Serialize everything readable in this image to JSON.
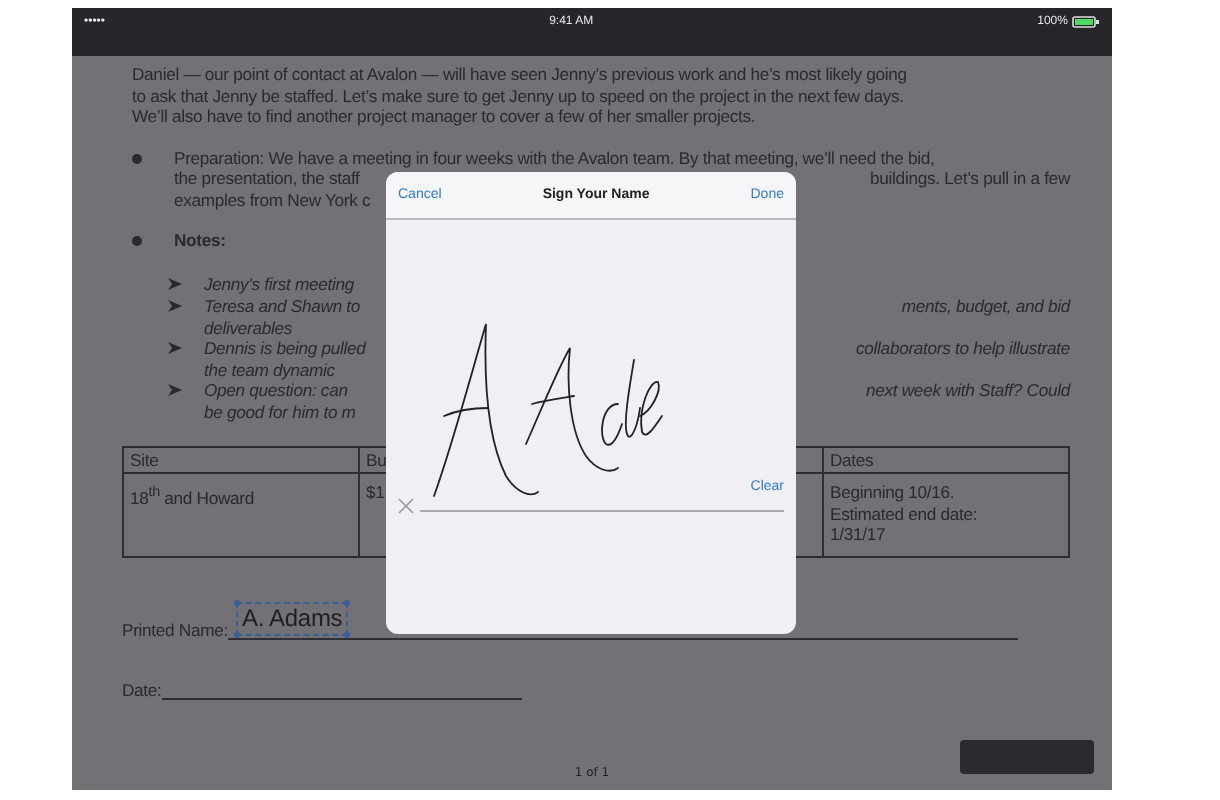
{
  "status_bar": {
    "signal": "•••••",
    "time": "9:41 AM",
    "battery": "100%"
  },
  "document": {
    "items": [
      {
        "kind": "continuation",
        "lines": [
          {
            "left": "Daniel — our point of contact at Avalon — will have seen Jenny’s previous work and he’s most likely going"
          },
          {
            "left": "to ask that Jenny be staffed. Let’s make sure to get Jenny up to speed on the project in the next few days."
          },
          {
            "left": "We’ll also have to find another project manager to cover a few of her smaller projects."
          }
        ]
      },
      {
        "kind": "bullet",
        "lines": [
          {
            "left": "Preparation: We have a meeting in four weeks with the Avalon team. By that meeting, we’ll need the bid,"
          },
          {
            "left": "the presentation, the staff",
            "right": "buildings. Let’s pull in a few"
          },
          {
            "left": "examples from New York c"
          }
        ]
      },
      {
        "kind": "heading",
        "lines": [
          {
            "left": "Notes:"
          }
        ]
      },
      {
        "kind": "arrow",
        "lines": [
          {
            "left": "Jenny’s first meeting"
          }
        ]
      },
      {
        "kind": "arrow",
        "lines": [
          {
            "left": "Teresa and Shawn to",
            "right": "ments, budget, and bid"
          },
          {
            "left": "deliverables"
          }
        ]
      },
      {
        "kind": "arrow",
        "lines": [
          {
            "left": "Dennis is being pulled",
            "right": "collaborators to help illustrate"
          },
          {
            "left": "the team dynamic"
          }
        ]
      },
      {
        "kind": "arrow",
        "lines": [
          {
            "left": "Open question: can",
            "right": "next week with Staff? Could"
          },
          {
            "left": "be good for him to m"
          }
        ]
      }
    ],
    "table": {
      "columns": [
        {
          "header": "Site",
          "cell_lines": [
            "18$^{th}$ and Howard"
          ]
        },
        {
          "header": "Bu",
          "cell_lines": [
            "$1"
          ]
        },
        {
          "header": "Dates",
          "cell_lines": [
            "Beginning 10/16.",
            "Estimated end date:",
            "1/31/17"
          ]
        }
      ]
    },
    "printed_name": {
      "label": "Printed Name:",
      "value": "A. Adams",
      "selected": true
    },
    "date": {
      "label": "Date:"
    },
    "page_indicator": "1 of 1"
  },
  "dialog": {
    "cancel": "Cancel",
    "title": "Sign Your Name",
    "done": "Done",
    "clear": "Clear"
  }
}
